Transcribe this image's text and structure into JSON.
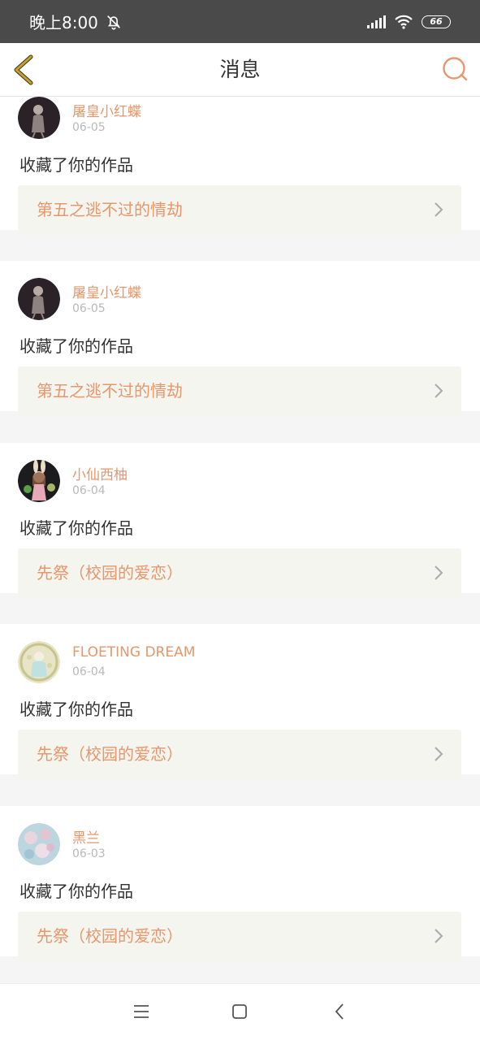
{
  "status": {
    "time": "晚上8:00",
    "battery": "66"
  },
  "header": {
    "title": "消息"
  },
  "messages": [
    {
      "user": "屠皇小红蝶",
      "date": "06-05",
      "action": "收藏了你的作品",
      "work": "第五之逃不过的情劫",
      "avatar": "dark-figure"
    },
    {
      "user": "屠皇小红蝶",
      "date": "06-05",
      "action": "收藏了你的作品",
      "work": "第五之逃不过的情劫",
      "avatar": "dark-figure"
    },
    {
      "user": "小仙西柚",
      "date": "06-04",
      "action": "收藏了你的作品",
      "work": "先祭（校园的爱恋）",
      "avatar": "bunny-girl"
    },
    {
      "user": "FLOETING DREAM",
      "date": "06-04",
      "action": "收藏了你的作品",
      "work": "先祭（校园的爱恋）",
      "avatar": "light-green"
    },
    {
      "user": "黑兰",
      "date": "06-03",
      "action": "收藏了你的作品",
      "work": "先祭（校园的爱恋）",
      "avatar": "blossom"
    }
  ],
  "colors": {
    "accent": "#e8966a",
    "back_icon": "#c8a21e",
    "status_bar": "#4a4a4a",
    "work_box": "#f5f5ef"
  },
  "icons": {
    "back": "chevron-left-icon",
    "chat": "chat-bubble-icon",
    "row": "chevron-right-icon",
    "nav_menu": "menu-icon",
    "nav_home": "home-square-icon",
    "nav_back": "back-icon"
  }
}
